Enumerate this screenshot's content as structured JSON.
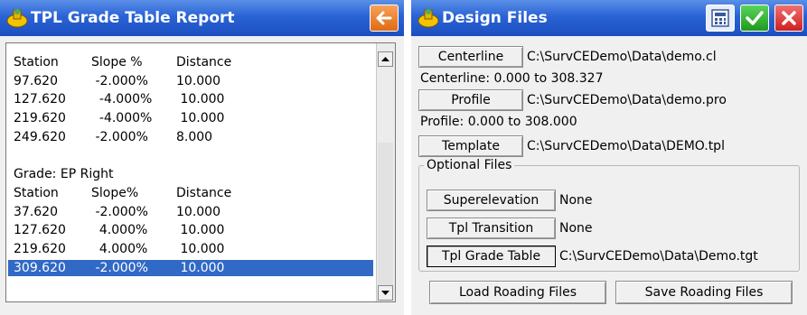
{
  "left_window": {
    "title": "TPL Grade Table Report",
    "logo_icon": "survce-logo-icon",
    "back_icon": "back-arrow-icon",
    "report_lines": [
      {
        "c1": "Station",
        "c2": "Slope %",
        "c3": "Distance"
      },
      {
        "c1": "97.620",
        "c2": " -2.000%",
        "c3": "10.000"
      },
      {
        "c1": "127.620",
        "c2": "  -4.000%",
        "c3": " 10.000"
      },
      {
        "c1": "219.620",
        "c2": "  -4.000%",
        "c3": " 10.000"
      },
      {
        "c1": "249.620",
        "c2": " -2.000%",
        "c3": "8.000"
      },
      {
        "c1": "",
        "c2": "",
        "c3": ""
      },
      {
        "c1": "Grade: EP Right",
        "c2": "",
        "c3": ""
      },
      {
        "c1": "Station",
        "c2": "Slope%",
        "c3": "Distance"
      },
      {
        "c1": "37.620",
        "c2": " -2.000%",
        "c3": "10.000"
      },
      {
        "c1": "127.620",
        "c2": "  4.000%",
        "c3": " 10.000"
      },
      {
        "c1": "219.620",
        "c2": "  4.000%",
        "c3": " 10.000"
      },
      {
        "c1": "309.620",
        "c2": " -2.000%",
        "c3": " 10.000"
      }
    ],
    "selected_index": 11
  },
  "right_window": {
    "title": "Design Files",
    "icons": [
      "survce-logo-icon",
      "calculator-icon",
      "checkmark-icon",
      "close-icon"
    ],
    "centerline": {
      "button": "Centerline",
      "path": "C:\\SurvCEDemo\\Data\\demo.cl",
      "info": "Centerline: 0.000 to 308.327"
    },
    "profile": {
      "button": "Profile",
      "path": "C:\\SurvCEDemo\\Data\\demo.pro",
      "info": "Profile: 0.000 to 308.000"
    },
    "template": {
      "button": "Template",
      "path": "C:\\SurvCEDemo\\Data\\DEMO.tpl"
    },
    "optional_files": {
      "legend": "Optional Files",
      "superelevation": {
        "button": "Superelevation",
        "value": "None"
      },
      "tpl_transition": {
        "button": "Tpl Transition",
        "value": "None"
      },
      "tpl_grade_table": {
        "button": "Tpl Grade Table",
        "value": "C:\\SurvCEDemo\\Data\\Demo.tgt"
      }
    },
    "load_button": "Load Roading Files",
    "save_button": "Save Roading Files"
  },
  "colors": {
    "titlebar": "#2a63d6",
    "selection": "#3169c6",
    "back_button": "#e06a14",
    "ok_button": "#1f9a1f",
    "close_button": "#d02020"
  }
}
